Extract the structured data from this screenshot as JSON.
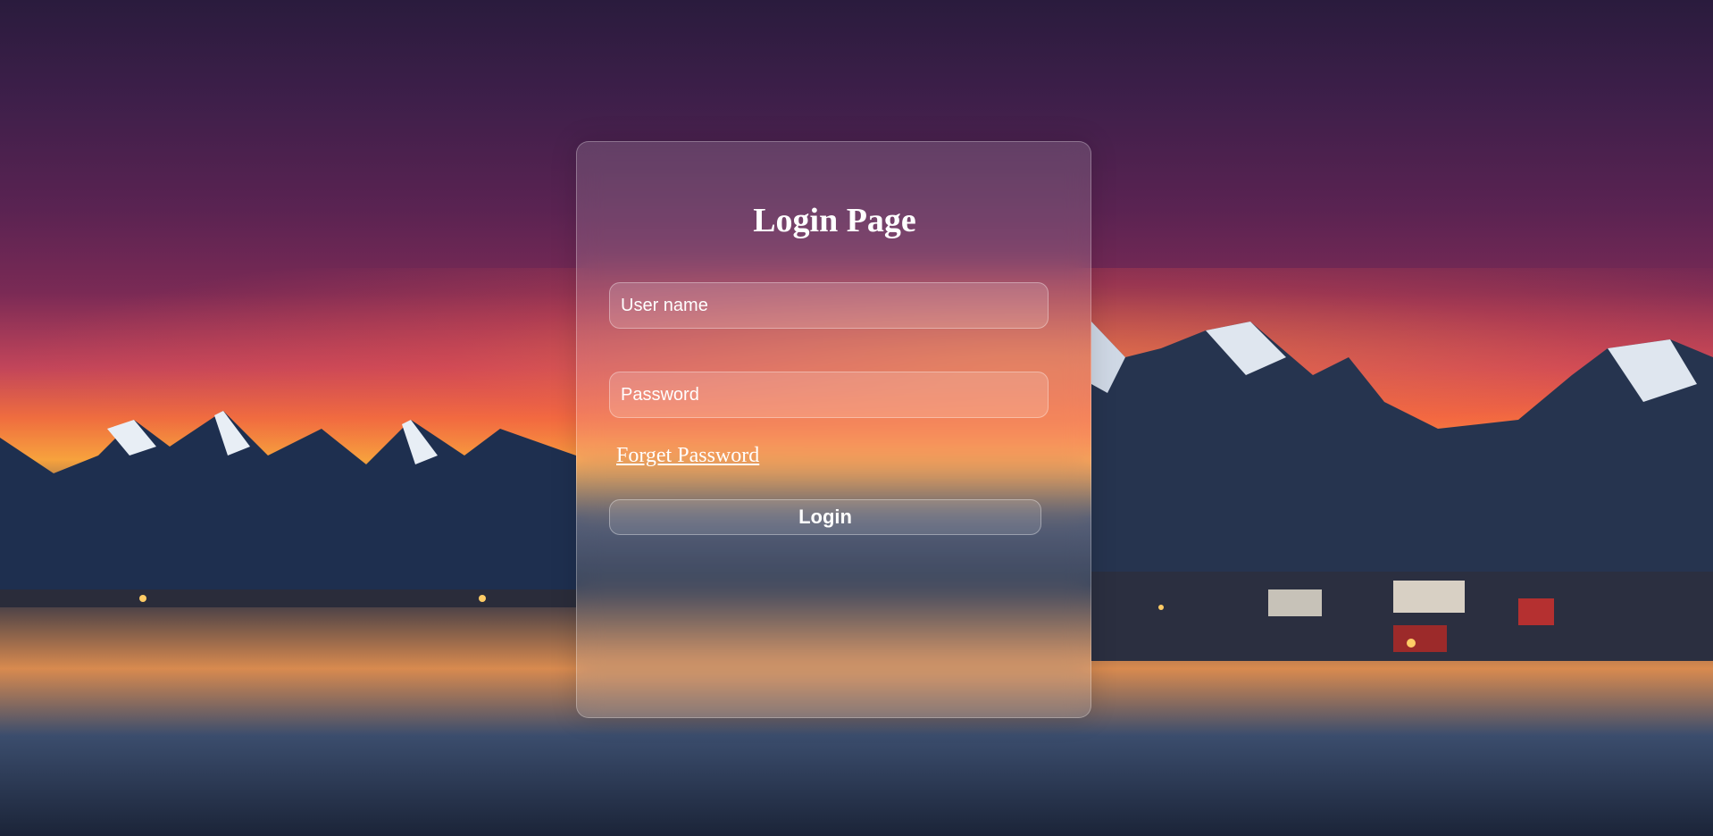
{
  "page": {
    "background": "mountain-lake-sunset-image"
  },
  "login": {
    "title": "Login Page",
    "username_placeholder": "User name",
    "username_value": "",
    "password_placeholder": "Password",
    "password_value": "",
    "forget_password_label": "Forget Password",
    "login_button_label": "Login"
  },
  "colors": {
    "text": "#ffffff",
    "panel_tint": "rgba(255,255,255,0.14)"
  }
}
